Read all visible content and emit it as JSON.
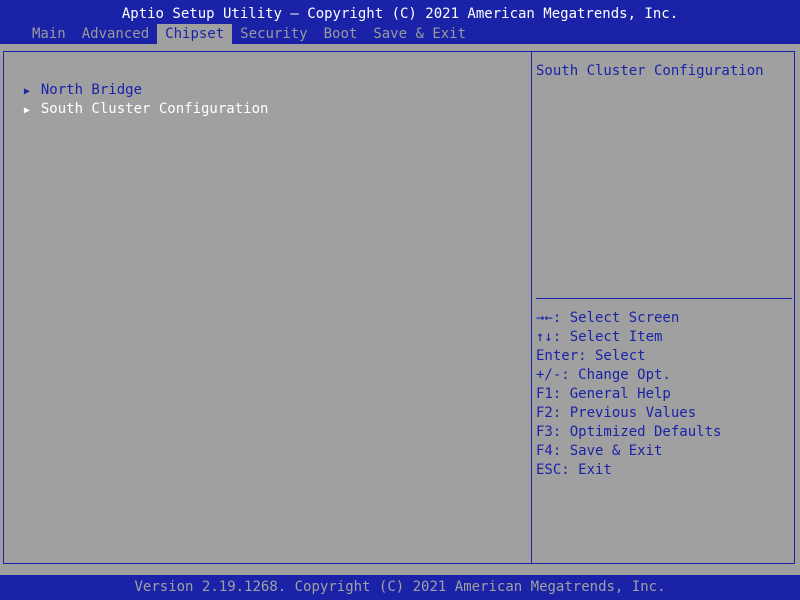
{
  "header": {
    "title": "Aptio Setup Utility – Copyright (C) 2021 American Megatrends, Inc.",
    "tabs": [
      {
        "label": "Main"
      },
      {
        "label": "Advanced"
      },
      {
        "label": "Chipset"
      },
      {
        "label": "Security"
      },
      {
        "label": "Boot"
      },
      {
        "label": "Save & Exit"
      }
    ],
    "active_tab": "Chipset"
  },
  "menu": {
    "arrow": "▶",
    "items": [
      {
        "label": "North Bridge"
      },
      {
        "label": "South Cluster Configuration"
      }
    ],
    "selected": "South Cluster Configuration"
  },
  "help": {
    "title": "South Cluster Configuration",
    "keys": [
      "→←: Select Screen",
      "↑↓: Select Item",
      "Enter: Select",
      "+/-: Change Opt.",
      "F1: General Help",
      "F2: Previous Values",
      "F3: Optimized Defaults",
      "F4: Save & Exit",
      "ESC: Exit"
    ]
  },
  "footer": {
    "text": "Version 2.19.1268. Copyright (C) 2021 American Megatrends, Inc."
  },
  "colors": {
    "accent": "#1a23a8",
    "background": "#a0a0a0",
    "highlight_text": "#ffffff"
  }
}
